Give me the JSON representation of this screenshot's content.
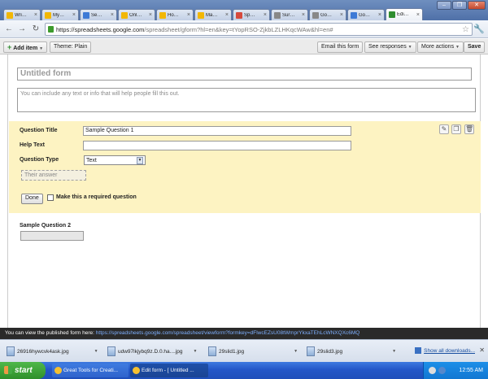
{
  "browser": {
    "tabs": [
      {
        "label": "Wri…",
        "favicon_color": "#f2b705"
      },
      {
        "label": "My…",
        "favicon_color": "#f2b705"
      },
      {
        "label": "Se…",
        "favicon_color": "#3d7ad6"
      },
      {
        "label": "Onl…",
        "favicon_color": "#f2b705"
      },
      {
        "label": "Ho…",
        "favicon_color": "#f2b705"
      },
      {
        "label": "Ma…",
        "favicon_color": "#f2b705"
      },
      {
        "label": "Sp…",
        "favicon_color": "#d64a3d"
      },
      {
        "label": "Sur…",
        "favicon_color": "#888888"
      },
      {
        "label": "Go…",
        "favicon_color": "#888888"
      },
      {
        "label": "Go…",
        "favicon_color": "#3d7ad6"
      },
      {
        "label": "Edi…",
        "favicon_color": "#2f8d2f"
      }
    ],
    "url_host": "https://spreadsheets.google.com",
    "url_rest": "/spreadsheet/gform?hl=en&key=tYopRSO-ZjkbLZLHKqcWAw&hl=en#"
  },
  "form_toolbar": {
    "add_item": "Add item",
    "theme": "Theme:  Plain",
    "email": "Email this form",
    "see_responses": "See responses",
    "more_actions": "More actions",
    "save": "Save"
  },
  "form": {
    "title_placeholder": "Untitled form",
    "description_placeholder": "You can include any text or info that will help people fill this out.",
    "question1": {
      "title_label": "Question Title",
      "title_value": "Sample Question 1",
      "help_label": "Help Text",
      "help_value": "",
      "type_label": "Question Type",
      "type_value": "Text",
      "answer_preview": "Their answer",
      "done": "Done",
      "required_label": "Make this a required question"
    },
    "question2": {
      "title": "Sample Question 2"
    }
  },
  "published_bar": {
    "prefix": "You can view the published form here: ",
    "link": "https://spreadsheets.google.com/spreadsheet/viewform?formkey=dFlwcEZsU08tWmprYkxaTEhLcWNXQXc6MQ"
  },
  "downloads": {
    "items": [
      {
        "name": "26916hywcvk4ask.jpg"
      },
      {
        "name": "udw97lkjybq9z.D.0.ha....jpg"
      },
      {
        "name": "29slid1.jpg"
      },
      {
        "name": "29slid3.jpg"
      }
    ],
    "show_all": "Show all downloads..."
  },
  "taskbar": {
    "start": "start",
    "tasks": [
      {
        "label": "Great Tools for Creati..."
      },
      {
        "label": "Edit form - [ Untitled ..."
      }
    ],
    "clock": "12:55 AM"
  },
  "colors": {
    "question_bg": "#fdf3c2",
    "taskbar_blue": "#2457c8",
    "start_green": "#2f8f2b"
  }
}
